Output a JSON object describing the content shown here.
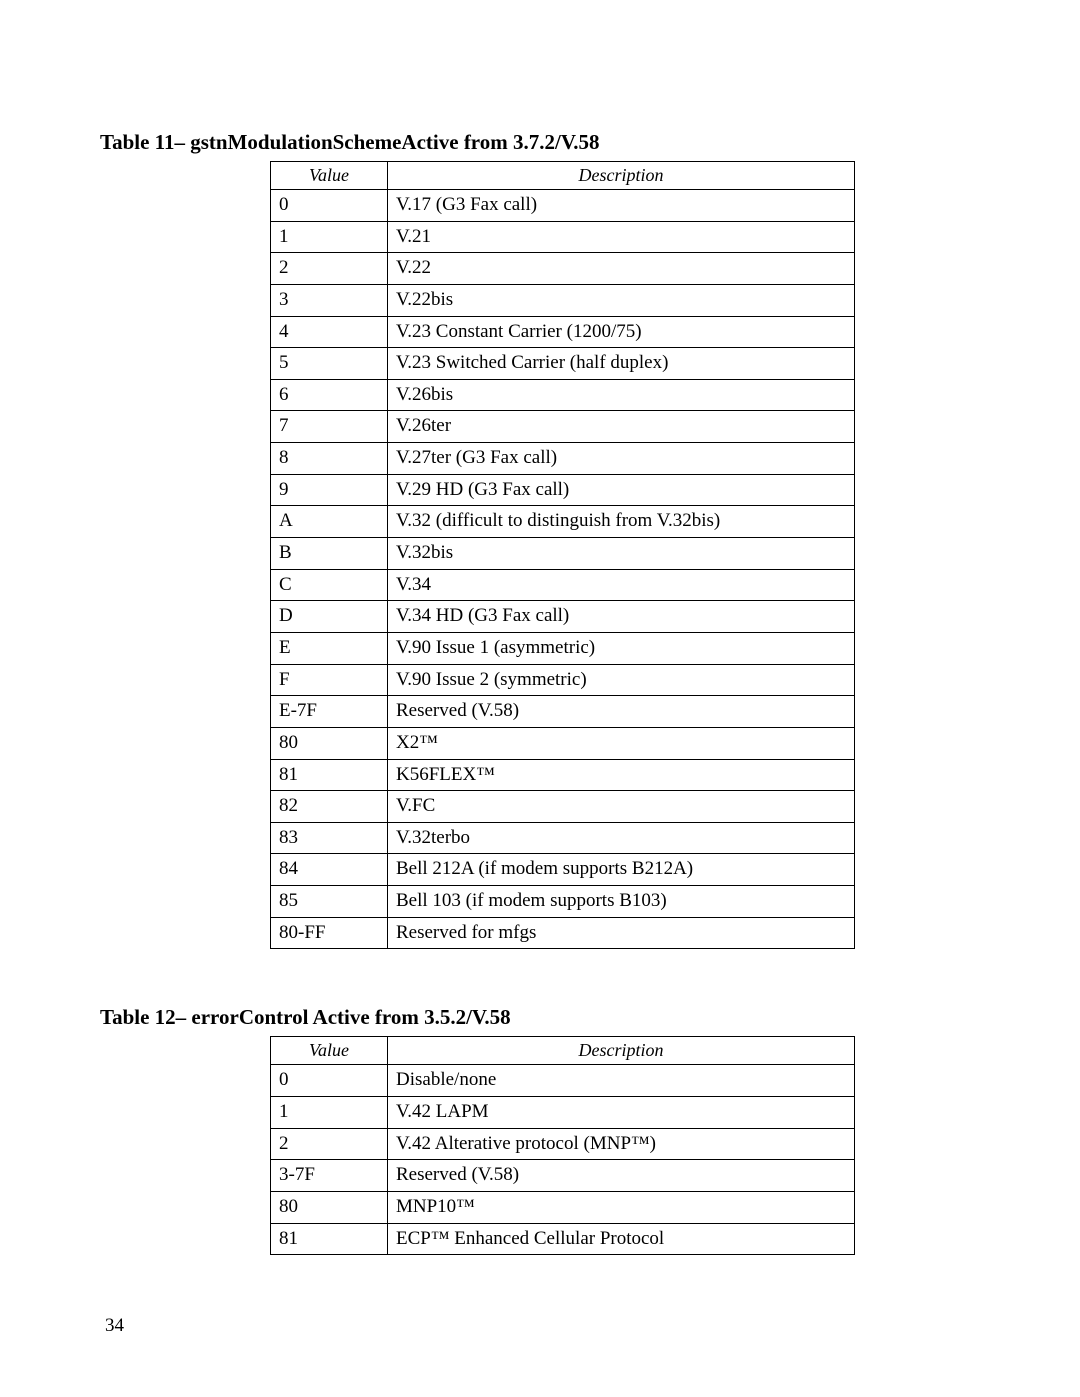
{
  "page_number": "34",
  "table11": {
    "title": "Table 11– gstnModulationSchemeActive from 3.7.2/V.58",
    "headers": {
      "value": "Value",
      "description": "Description"
    },
    "rows": [
      {
        "v": "0",
        "d": "V.17 (G3 Fax call)"
      },
      {
        "v": "1",
        "d": "V.21"
      },
      {
        "v": "2",
        "d": "V.22"
      },
      {
        "v": "3",
        "d": "V.22bis"
      },
      {
        "v": "4",
        "d": "V.23 Constant Carrier (1200/75)"
      },
      {
        "v": "5",
        "d": "V.23 Switched Carrier (half duplex)"
      },
      {
        "v": "6",
        "d": "V.26bis"
      },
      {
        "v": "7",
        "d": "V.26ter"
      },
      {
        "v": "8",
        "d": "V.27ter (G3 Fax call)"
      },
      {
        "v": "9",
        "d": "V.29 HD (G3 Fax call)"
      },
      {
        "v": "A",
        "d": "V.32 (difficult to distinguish from V.32bis)"
      },
      {
        "v": "B",
        "d": "V.32bis"
      },
      {
        "v": "C",
        "d": "V.34"
      },
      {
        "v": "D",
        "d": "V.34 HD (G3 Fax call)"
      },
      {
        "v": "E",
        "d": "V.90 Issue 1 (asymmetric)"
      },
      {
        "v": "F",
        "d": "V.90 Issue 2 (symmetric)"
      },
      {
        "v": "E-7F",
        "d": "Reserved (V.58)"
      },
      {
        "v": "80",
        "d": "X2™"
      },
      {
        "v": "81",
        "d": "K56FLEX™"
      },
      {
        "v": "82",
        "d": "V.FC"
      },
      {
        "v": "83",
        "d": "V.32terbo"
      },
      {
        "v": "84",
        "d": "Bell 212A (if modem supports B212A)"
      },
      {
        "v": "85",
        "d": "Bell 103 (if modem supports B103)"
      },
      {
        "v": "80-FF",
        "d": "Reserved for mfgs"
      }
    ]
  },
  "table12": {
    "title": "Table 12– errorControl Active from 3.5.2/V.58",
    "headers": {
      "value": "Value",
      "description": "Description"
    },
    "rows": [
      {
        "v": "0",
        "d": "Disable/none"
      },
      {
        "v": "1",
        "d": "V.42 LAPM"
      },
      {
        "v": "2",
        "d": "V.42 Alterative protocol (MNP™)"
      },
      {
        "v": "3-7F",
        "d": "Reserved (V.58)"
      },
      {
        "v": "80",
        "d": "MNP10™"
      },
      {
        "v": "81",
        "d": "ECP™ Enhanced Cellular Protocol"
      }
    ]
  }
}
